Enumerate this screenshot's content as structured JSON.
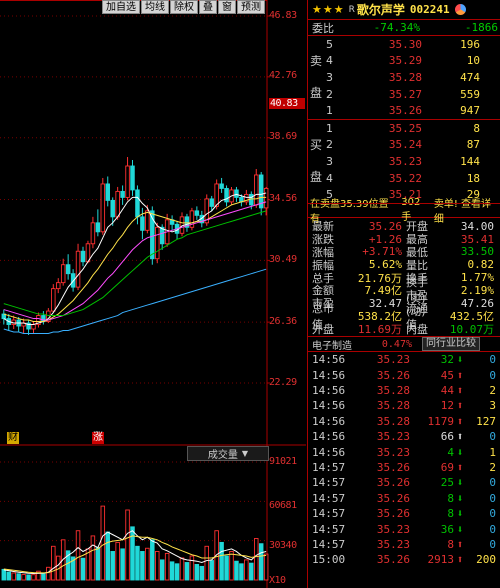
{
  "toolbar": {
    "buttons": [
      "加自选",
      "均线",
      "除权",
      "叠",
      "窗",
      "预测"
    ]
  },
  "price_axis": {
    "ticks": [
      "46.83",
      "42.76",
      "38.69",
      "34.56",
      "30.49",
      "26.36",
      "22.29"
    ],
    "current_price": "40.83"
  },
  "markers": {
    "finance": "财",
    "limit_up": "涨"
  },
  "volume_panel": {
    "tab_label": "成交量",
    "ticks": [
      "91021",
      "60681",
      "30340"
    ],
    "unit": "X10"
  },
  "stock": {
    "stars": "★★★",
    "market_flag": "R",
    "name": "歌尔声学",
    "code": "002241"
  },
  "weibi": {
    "label": "委比",
    "ratio": "-74.34%",
    "diff": "-1866"
  },
  "sell_orders": {
    "side_label_top": "卖",
    "side_label_bottom": "盘",
    "rows": [
      {
        "level": "5",
        "price": "35.30",
        "vol": "196"
      },
      {
        "level": "4",
        "price": "35.29",
        "vol": "10"
      },
      {
        "level": "3",
        "price": "35.28",
        "vol": "474"
      },
      {
        "level": "2",
        "price": "35.27",
        "vol": "559"
      },
      {
        "level": "1",
        "price": "35.26",
        "vol": "947"
      }
    ]
  },
  "buy_orders": {
    "side_label_top": "买",
    "side_label_bottom": "盘",
    "rows": [
      {
        "level": "1",
        "price": "35.25",
        "vol": "8"
      },
      {
        "level": "2",
        "price": "35.24",
        "vol": "87"
      },
      {
        "level": "3",
        "price": "35.23",
        "vol": "144"
      },
      {
        "level": "4",
        "price": "35.22",
        "vol": "18"
      },
      {
        "level": "5",
        "price": "35.21",
        "vol": "29"
      }
    ]
  },
  "info_bar": {
    "text_a": "在卖盘35.39位置有",
    "text_b": "302手",
    "text_c": "卖单! 查看详细"
  },
  "quote": [
    {
      "l": "最新",
      "v": "35.26",
      "vc": "red",
      "r": "开盘",
      "v2": "34.00",
      "v2c": "wht"
    },
    {
      "l": "涨跌",
      "v": "+1.26",
      "vc": "red",
      "r": "最高",
      "v2": "35.41",
      "v2c": "red"
    },
    {
      "l": "涨幅",
      "v": "+3.71%",
      "vc": "red",
      "r": "最低",
      "v2": "33.50",
      "v2c": "grn"
    },
    {
      "l": "振幅",
      "v": "5.62%",
      "vc": "yel",
      "r": "量比",
      "v2": "0.82",
      "v2c": "yel"
    },
    {
      "l": "总手",
      "v": "21.76万",
      "vc": "yel",
      "r": "换手",
      "v2": "1.77%",
      "v2c": "yel"
    },
    {
      "l": "金额",
      "v": "7.49亿",
      "vc": "yel",
      "r": "换手(实)",
      "v2": "2.19%",
      "v2c": "yel"
    },
    {
      "l": "市盈",
      "v": "32.47",
      "vc": "wht",
      "r": "市盈(动)",
      "v2": "47.26",
      "v2c": "wht"
    },
    {
      "l": "总市值",
      "v": "538.2亿",
      "vc": "yel",
      "r": "流通值",
      "v2": "432.5亿",
      "v2c": "yel"
    },
    {
      "l": "外盘",
      "v": "11.69万",
      "vc": "red",
      "r": "内盘",
      "v2": "10.07万",
      "v2c": "grn"
    }
  ],
  "industry": {
    "label": "电子制造",
    "change": "0.47%",
    "tab": "同行业比较"
  },
  "ticks": [
    {
      "t": "14:56",
      "p": "35.23",
      "v": "32",
      "vc": "grn",
      "a": "down",
      "n": "0"
    },
    {
      "t": "14:56",
      "p": "35.26",
      "v": "45",
      "vc": "red",
      "a": "up",
      "n": "0"
    },
    {
      "t": "14:56",
      "p": "35.28",
      "v": "44",
      "vc": "red",
      "a": "up",
      "n": "2"
    },
    {
      "t": "14:56",
      "p": "35.28",
      "v": "12",
      "vc": "red",
      "a": "up",
      "n": "3"
    },
    {
      "t": "14:56",
      "p": "35.28",
      "v": "1179",
      "vc": "red",
      "a": "up",
      "n": "127"
    },
    {
      "t": "14:56",
      "p": "35.23",
      "v": "66",
      "vc": "wht",
      "a": "neutral",
      "n": "0"
    },
    {
      "t": "14:56",
      "p": "35.23",
      "v": "4",
      "vc": "grn",
      "a": "down",
      "n": "1"
    },
    {
      "t": "14:57",
      "p": "35.26",
      "v": "69",
      "vc": "red",
      "a": "up",
      "n": "2"
    },
    {
      "t": "14:57",
      "p": "35.26",
      "v": "25",
      "vc": "grn",
      "a": "down",
      "n": "0"
    },
    {
      "t": "14:57",
      "p": "35.26",
      "v": "8",
      "vc": "grn",
      "a": "down",
      "n": "0"
    },
    {
      "t": "14:57",
      "p": "35.26",
      "v": "8",
      "vc": "grn",
      "a": "down",
      "n": "0"
    },
    {
      "t": "14:57",
      "p": "35.23",
      "v": "36",
      "vc": "grn",
      "a": "down",
      "n": "0"
    },
    {
      "t": "14:57",
      "p": "35.23",
      "v": "8",
      "vc": "red",
      "a": "up",
      "n": "0"
    },
    {
      "t": "15:00",
      "p": "35.26",
      "v": "2913",
      "vc": "red",
      "a": "up",
      "n": "200"
    }
  ],
  "chart_data": {
    "type": "candlestick",
    "price_ylim": [
      22.29,
      46.83
    ],
    "candles": [
      {
        "o": 26.9,
        "c": 26.6,
        "h": 27.2,
        "l": 26.2
      },
      {
        "o": 26.6,
        "c": 26.2,
        "h": 26.9,
        "l": 25.8
      },
      {
        "o": 26.2,
        "c": 26.5,
        "h": 26.8,
        "l": 25.9
      },
      {
        "o": 26.5,
        "c": 26.1,
        "h": 26.7,
        "l": 25.7
      },
      {
        "o": 26.1,
        "c": 26.3,
        "h": 26.6,
        "l": 25.6
      },
      {
        "o": 26.3,
        "c": 25.9,
        "h": 26.5,
        "l": 25.5
      },
      {
        "o": 25.9,
        "c": 26.2,
        "h": 26.4,
        "l": 25.6
      },
      {
        "o": 26.2,
        "c": 26.8,
        "h": 27.0,
        "l": 26.0
      },
      {
        "o": 26.8,
        "c": 26.4,
        "h": 27.1,
        "l": 26.2
      },
      {
        "o": 26.4,
        "c": 27.1,
        "h": 27.3,
        "l": 26.3
      },
      {
        "o": 27.1,
        "c": 28.6,
        "h": 28.9,
        "l": 27.0
      },
      {
        "o": 28.6,
        "c": 29.0,
        "h": 29.3,
        "l": 28.3
      },
      {
        "o": 29.0,
        "c": 30.2,
        "h": 30.6,
        "l": 28.8
      },
      {
        "o": 30.2,
        "c": 29.6,
        "h": 30.9,
        "l": 29.2
      },
      {
        "o": 29.6,
        "c": 28.7,
        "h": 29.9,
        "l": 28.4
      },
      {
        "o": 28.7,
        "c": 31.1,
        "h": 31.6,
        "l": 28.5
      },
      {
        "o": 31.1,
        "c": 30.4,
        "h": 31.4,
        "l": 30.1
      },
      {
        "o": 30.4,
        "c": 31.6,
        "h": 31.8,
        "l": 30.3
      },
      {
        "o": 31.6,
        "c": 33.0,
        "h": 33.4,
        "l": 31.3
      },
      {
        "o": 33.0,
        "c": 32.4,
        "h": 33.9,
        "l": 32.1
      },
      {
        "o": 32.4,
        "c": 35.6,
        "h": 36.0,
        "l": 32.2
      },
      {
        "o": 35.6,
        "c": 34.5,
        "h": 36.1,
        "l": 34.1
      },
      {
        "o": 34.5,
        "c": 33.4,
        "h": 34.7,
        "l": 32.8
      },
      {
        "o": 33.4,
        "c": 35.1,
        "h": 35.4,
        "l": 33.2
      },
      {
        "o": 35.1,
        "c": 34.7,
        "h": 35.5,
        "l": 34.2
      },
      {
        "o": 34.7,
        "c": 36.8,
        "h": 37.4,
        "l": 34.5
      },
      {
        "o": 36.8,
        "c": 35.2,
        "h": 37.2,
        "l": 34.8
      },
      {
        "o": 35.2,
        "c": 33.4,
        "h": 35.5,
        "l": 32.9
      },
      {
        "o": 33.4,
        "c": 32.5,
        "h": 34.0,
        "l": 31.9
      },
      {
        "o": 32.5,
        "c": 33.8,
        "h": 34.2,
        "l": 32.3
      },
      {
        "o": 33.8,
        "c": 30.6,
        "h": 34.1,
        "l": 30.2
      },
      {
        "o": 30.6,
        "c": 32.7,
        "h": 33.0,
        "l": 30.3
      },
      {
        "o": 32.7,
        "c": 31.6,
        "h": 32.9,
        "l": 31.2
      },
      {
        "o": 31.6,
        "c": 33.2,
        "h": 33.6,
        "l": 31.4
      },
      {
        "o": 33.2,
        "c": 32.9,
        "h": 33.5,
        "l": 32.5
      },
      {
        "o": 32.9,
        "c": 32.3,
        "h": 33.1,
        "l": 31.9
      },
      {
        "o": 32.3,
        "c": 33.4,
        "h": 33.7,
        "l": 32.1
      },
      {
        "o": 33.4,
        "c": 32.7,
        "h": 33.6,
        "l": 32.4
      },
      {
        "o": 32.7,
        "c": 33.8,
        "h": 34.0,
        "l": 32.5
      },
      {
        "o": 33.8,
        "c": 33.5,
        "h": 34.1,
        "l": 33.2
      },
      {
        "o": 33.5,
        "c": 33.0,
        "h": 33.8,
        "l": 32.7
      },
      {
        "o": 33.0,
        "c": 34.6,
        "h": 34.9,
        "l": 32.8
      },
      {
        "o": 34.6,
        "c": 34.1,
        "h": 34.8,
        "l": 33.8
      },
      {
        "o": 34.1,
        "c": 35.6,
        "h": 35.9,
        "l": 33.9
      },
      {
        "o": 35.6,
        "c": 35.3,
        "h": 36.0,
        "l": 35.0
      },
      {
        "o": 35.3,
        "c": 34.4,
        "h": 35.5,
        "l": 34.1
      },
      {
        "o": 34.4,
        "c": 35.2,
        "h": 35.4,
        "l": 34.2
      },
      {
        "o": 35.2,
        "c": 34.7,
        "h": 35.4,
        "l": 34.4
      },
      {
        "o": 34.7,
        "c": 34.4,
        "h": 34.9,
        "l": 34.1
      },
      {
        "o": 34.4,
        "c": 34.9,
        "h": 35.2,
        "l": 34.2
      },
      {
        "o": 34.9,
        "c": 34.2,
        "h": 35.1,
        "l": 33.9
      },
      {
        "o": 34.2,
        "c": 36.2,
        "h": 36.6,
        "l": 34.0
      },
      {
        "o": 36.2,
        "c": 34.0,
        "h": 36.4,
        "l": 33.5
      },
      {
        "o": 34.0,
        "c": 35.3,
        "h": 35.4,
        "l": 33.5
      }
    ],
    "ma_lines": [
      {
        "color": "#ffffff",
        "values": [
          26.6,
          26.4,
          26.3,
          26.3,
          26.3,
          26.2,
          26.2,
          26.3,
          26.4,
          26.6,
          27.0,
          27.5,
          28.1,
          28.7,
          29.1,
          29.5,
          29.9,
          30.4,
          30.9,
          31.3,
          32.0,
          32.7,
          33.0,
          33.4,
          33.9,
          34.4,
          34.7,
          34.7,
          34.3,
          34.0,
          33.3,
          32.8,
          32.6,
          32.5,
          32.4,
          32.5,
          32.8,
          32.9,
          33.0,
          33.1,
          33.3,
          33.6,
          33.8,
          34.2,
          34.5,
          34.6,
          34.8,
          34.9,
          34.8,
          34.7,
          34.7,
          34.9,
          34.9,
          35.0
        ]
      },
      {
        "color": "#ffe24a",
        "values": [
          26.9,
          26.8,
          26.7,
          26.6,
          26.5,
          26.5,
          26.4,
          26.4,
          26.4,
          26.5,
          26.7,
          26.9,
          27.2,
          27.5,
          27.8,
          28.2,
          28.6,
          29.0,
          29.5,
          29.9,
          30.4,
          30.9,
          31.3,
          31.8,
          32.2,
          32.7,
          33.1,
          33.4,
          33.6,
          33.7,
          33.6,
          33.5,
          33.4,
          33.3,
          33.2,
          33.1,
          33.0,
          33.0,
          33.0,
          33.1,
          33.1,
          33.2,
          33.4,
          33.6,
          33.8,
          34.0,
          34.2,
          34.3,
          34.4,
          34.5,
          34.6,
          34.6,
          34.7,
          34.7
        ]
      },
      {
        "color": "#ff4dff",
        "values": [
          27.2,
          27.1,
          27.0,
          26.9,
          26.8,
          26.7,
          26.6,
          26.6,
          26.5,
          26.5,
          26.6,
          26.7,
          26.8,
          27.0,
          27.2,
          27.4,
          27.6,
          27.9,
          28.2,
          28.5,
          28.9,
          29.3,
          29.6,
          30.0,
          30.4,
          30.8,
          31.2,
          31.5,
          31.8,
          32.0,
          32.1,
          32.2,
          32.3,
          32.4,
          32.5,
          32.6,
          32.7,
          32.8,
          32.9,
          33.0,
          33.1,
          33.2,
          33.3,
          33.4,
          33.5,
          33.6,
          33.7,
          33.8,
          33.9,
          34.0,
          34.1,
          34.2,
          34.3,
          34.4
        ]
      },
      {
        "color": "#00c000",
        "values": [
          27.6,
          27.5,
          27.4,
          27.3,
          27.2,
          27.1,
          27.0,
          26.9,
          26.9,
          26.8,
          26.8,
          26.8,
          26.8,
          26.9,
          27.0,
          27.1,
          27.2,
          27.4,
          27.6,
          27.8,
          28.0,
          28.3,
          28.6,
          28.9,
          29.2,
          29.5,
          29.8,
          30.1,
          30.4,
          30.7,
          30.9,
          31.1,
          31.3,
          31.5,
          31.7,
          31.9,
          32.0,
          32.2,
          32.3,
          32.4,
          32.5,
          32.6,
          32.7,
          32.8,
          32.9,
          33.0,
          33.1,
          33.2,
          33.3,
          33.4,
          33.5,
          33.6,
          33.7,
          33.8
        ]
      },
      {
        "color": "#3ab0ff",
        "values": [
          25.9,
          25.8,
          25.7,
          25.7,
          25.6,
          25.6,
          25.6,
          25.6,
          25.6,
          25.6,
          25.7,
          25.7,
          25.8,
          25.8,
          25.9,
          26.0,
          26.1,
          26.2,
          26.3,
          26.4,
          26.5,
          26.6,
          26.7,
          26.8,
          27.0,
          27.1,
          27.2,
          27.3,
          27.4,
          27.5,
          27.6,
          27.7,
          27.8,
          27.9,
          28.0,
          28.1,
          28.2,
          28.3,
          28.4,
          28.5,
          28.6,
          28.7,
          28.8,
          28.9,
          29.0,
          29.1,
          29.2,
          29.3,
          29.4,
          29.5,
          29.6,
          29.7,
          29.8,
          29.9
        ]
      }
    ],
    "volume_ylim": [
      0,
      91021
    ],
    "volumes": [
      8200,
      6100,
      5400,
      4800,
      4200,
      3900,
      4100,
      6800,
      5200,
      9800,
      26000,
      18400,
      31000,
      22500,
      17800,
      38000,
      16800,
      24000,
      34000,
      25000,
      57000,
      37000,
      22000,
      29000,
      24000,
      54000,
      41000,
      26000,
      22000,
      24500,
      31000,
      22000,
      15500,
      20500,
      14000,
      12500,
      17000,
      13500,
      18500,
      12000,
      10500,
      26000,
      15000,
      38000,
      29000,
      18500,
      22000,
      14500,
      12500,
      15500,
      13000,
      32000,
      28000,
      20000
    ],
    "volume_ma": [
      {
        "color": "#ffffff",
        "values": [
          7800,
          7200,
          6600,
          6000,
          5600,
          5200,
          5000,
          5100,
          5200,
          6000,
          9000,
          11500,
          16000,
          19000,
          21500,
          25000,
          22000,
          24000,
          27000,
          25000,
          34000,
          37000,
          35000,
          33000,
          31000,
          36000,
          38000,
          34000,
          31000,
          33000,
          30000,
          28500,
          24000,
          22500,
          20500,
          18500,
          16500,
          15500,
          15000,
          14500,
          13500,
          15000,
          15500,
          19500,
          22000,
          23000,
          24000,
          22000,
          19000,
          17000,
          15500,
          19000,
          21000,
          22000
        ]
      },
      {
        "color": "#ffe24a",
        "values": [
          8500,
          8000,
          7500,
          7000,
          6500,
          6000,
          5700,
          5600,
          5500,
          5700,
          7000,
          8500,
          11000,
          13000,
          15000,
          17500,
          19000,
          21000,
          23000,
          24000,
          27000,
          29000,
          30000,
          30500,
          31000,
          32500,
          34000,
          33500,
          33000,
          33000,
          32000,
          31000,
          29000,
          27500,
          25500,
          24000,
          22500,
          21000,
          19500,
          18500,
          17000,
          17000,
          17000,
          18000,
          19000,
          19500,
          20000,
          19500,
          19000,
          18500,
          17500,
          18000,
          18500,
          19000
        ]
      }
    ]
  }
}
